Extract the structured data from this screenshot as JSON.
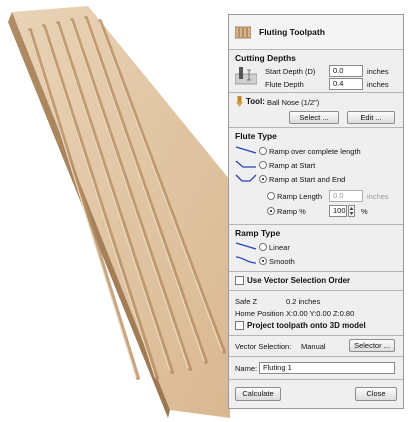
{
  "title": "Fluting Toolpath",
  "cutting_depths": {
    "heading": "Cutting Depths",
    "start_label": "Start Depth (D)",
    "start_value": "0.0",
    "flute_label": "Flute Depth",
    "flute_value": "0.4",
    "unit": "inches"
  },
  "tool": {
    "label": "Tool:",
    "name": "Ball Nose (1/2\")",
    "select_button": "Select ...",
    "edit_button": "Edit ..."
  },
  "flute_type": {
    "heading": "Flute Type",
    "options": [
      "Ramp over complete length",
      "Ramp at Start",
      "Ramp at Start and End"
    ],
    "ramp_length_label": "Ramp Length",
    "ramp_length_value": "0.0",
    "ramp_length_unit": "inches",
    "ramp_pct_label": "Ramp %",
    "ramp_pct_value": "100",
    "ramp_pct_unit": "%"
  },
  "ramp_type": {
    "heading": "Ramp Type",
    "options": [
      "Linear",
      "Smooth"
    ]
  },
  "use_vector_order": "Use Vector Selection Order",
  "safe_z": {
    "label": "Safe Z",
    "value": "0.2 inches"
  },
  "home_position": {
    "label": "Home Position",
    "value": "X:0.00 Y:0.00 Z:0.80"
  },
  "project_label": "Project toolpath onto 3D model",
  "vector_selection": {
    "label": "Vector Selection:",
    "value": "Manual",
    "button": "Selector ..."
  },
  "name": {
    "label": "Name:",
    "value": "Fluting 1"
  },
  "calculate_button": "Calculate",
  "close_button": "Close",
  "colors": {
    "panel_bg": "#efefef",
    "ramp_icon": "#2a3fbf",
    "wood_light": "#e2c7a6",
    "wood_dark": "#b89570"
  }
}
